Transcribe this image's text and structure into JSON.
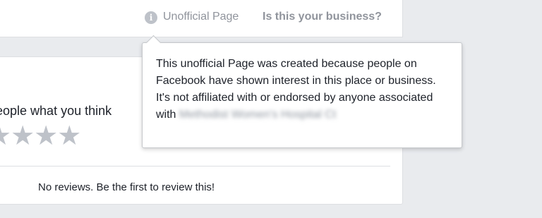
{
  "header": {
    "info_icon_glyph": "i",
    "unofficial_label": "Unofficial Page",
    "claim_link": "Is this your business?"
  },
  "reviews": {
    "prompt": "eople what you think",
    "stars": "★★★★",
    "empty_message": "No reviews. Be the first to review this!"
  },
  "tooltip": {
    "text": "This unofficial Page was created because people on Facebook have shown interest in this place or business. It's not affiliated with or endorsed by anyone associated with ",
    "blurred_name": "Methodist Women's Hospital Ct"
  },
  "colors": {
    "background": "#e9ebee",
    "muted_text": "#90949c",
    "star_empty": "#bec2c9"
  },
  "icons": [
    "info-icon",
    "star-icon"
  ]
}
